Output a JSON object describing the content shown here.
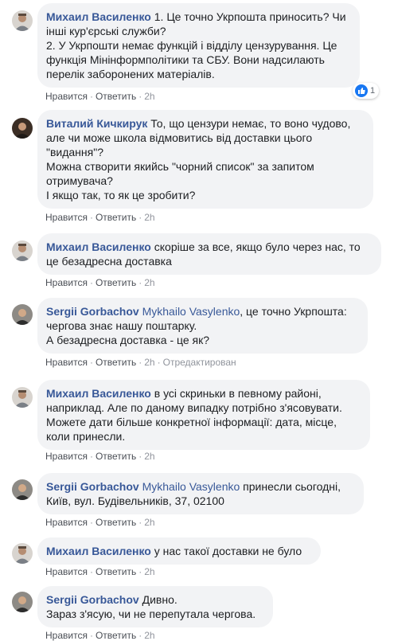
{
  "comments": [
    {
      "author": "Михаил Василенко",
      "mention": "",
      "text": " 1. Це точно Укрпошта приносить? Чи\nінші кур'єрські служби?\n2. У Укрпошти немає функцій і відділу цензурування. Це\nфункція Мінінформполітики та СБУ. Вони надсилають\nперелік заборонених матеріалів.",
      "like_label": "Нравится",
      "reply_label": "Ответить",
      "time": "2h",
      "edited": "",
      "reaction_count": "1",
      "avatar": "man-gray-shirt"
    },
    {
      "author": "Виталий Кичкирук",
      "mention": "",
      "text": " То, що цензури немає, то воно чудово,\nале чи може школа відмовитись від доставки цього\n\"видання\"?\nМожна створити якийсь \"чорний список\" за запитом\nотримувача?\nІ якщо так, то як це зробити?",
      "like_label": "Нравится",
      "reply_label": "Ответить",
      "time": "2h",
      "edited": "",
      "reaction_count": "",
      "avatar": "man-dark-photo"
    },
    {
      "author": "Михаил Василенко",
      "mention": "",
      "text": " скоріше за все, якщо було через нас, то\nце безадресна доставка",
      "like_label": "Нравится",
      "reply_label": "Ответить",
      "time": "2h",
      "edited": "",
      "reaction_count": "",
      "avatar": "man-gray-shirt"
    },
    {
      "author": "Sergii Gorbachov",
      "mention": "Mykhailo Vasylenko",
      "text": ", це точно Укрпошта:\nчергова знає нашу поштарку.\nА безадресна доставка - це як?",
      "like_label": "Нравится",
      "reply_label": "Ответить",
      "time": "2h",
      "edited": "Отредактирован",
      "reaction_count": "",
      "avatar": "man-portrait"
    },
    {
      "author": "Михаил Василенко",
      "mention": "",
      "text": " в усі скриньки в певному районі,\nнаприклад. Але по даному випадку потрібно з'ясовувати.\nМожете дати більше конкретної інформації: дата, місце,\nколи принесли.",
      "like_label": "Нравится",
      "reply_label": "Ответить",
      "time": "2h",
      "edited": "",
      "reaction_count": "",
      "avatar": "man-gray-shirt"
    },
    {
      "author": "Sergii Gorbachov",
      "mention": "Mykhailo Vasylenko",
      "text": " принесли сьогодні,\nКиїв, вул. Будівельників, 37, 02100",
      "like_label": "Нравится",
      "reply_label": "Ответить",
      "time": "2h",
      "edited": "",
      "reaction_count": "",
      "avatar": "man-portrait"
    },
    {
      "author": "Михаил Василенко",
      "mention": "",
      "text": " у нас такої доставки не було",
      "like_label": "Нравится",
      "reply_label": "Ответить",
      "time": "2h",
      "edited": "",
      "reaction_count": "",
      "avatar": "man-gray-shirt"
    },
    {
      "author": "Sergii Gorbachov",
      "mention": "",
      "text": " Дивно.\nЗараз з'ясую, чи не перепутала чергова.",
      "like_label": "Нравится",
      "reply_label": "Ответить",
      "time": "2h",
      "edited": "",
      "reaction_count": "",
      "avatar": "man-portrait"
    }
  ],
  "colors": {
    "author": "#385898",
    "bubble": "#f2f3f5",
    "meta": "#90949c",
    "like": "#1877f2"
  }
}
